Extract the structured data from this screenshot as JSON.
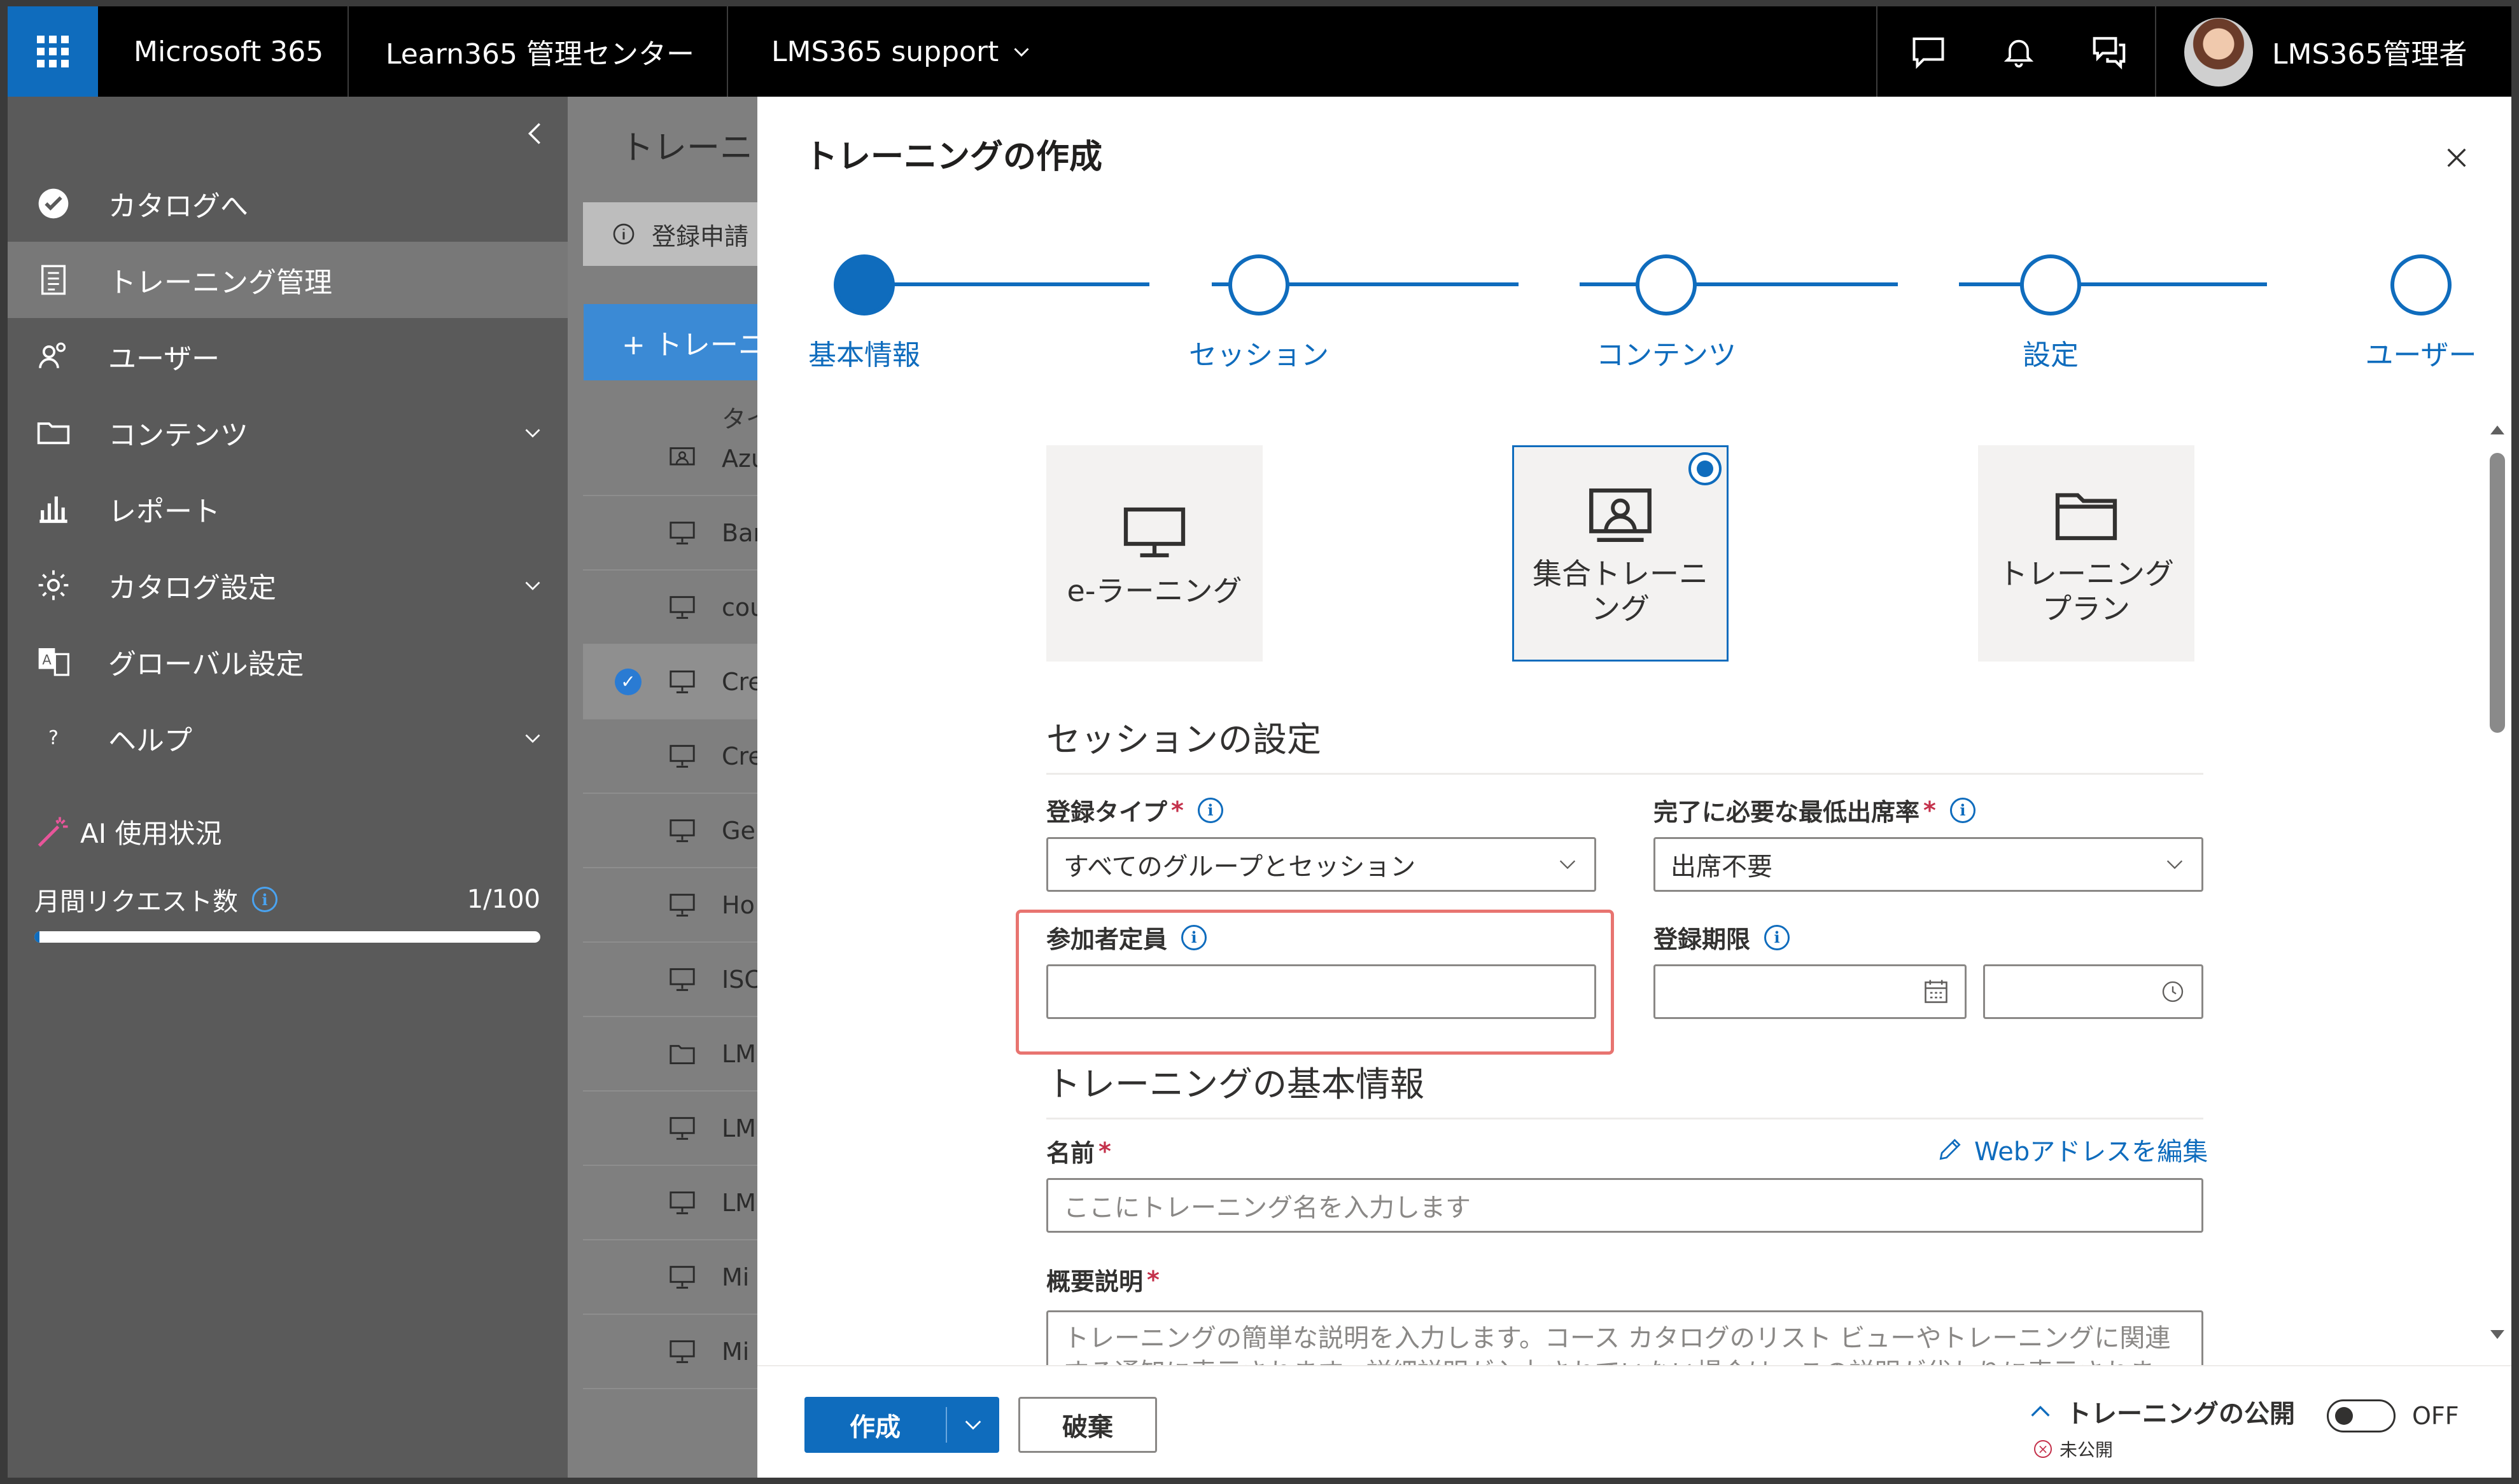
{
  "topbar": {
    "app_name": "Microsoft 365",
    "product_name": "Learn365 管理センター",
    "tenant_name": "LMS365 support",
    "user_name": "LMS365管理者"
  },
  "sidebar": {
    "items": [
      {
        "label": "カタログへ",
        "icon": "catalog-check-icon"
      },
      {
        "label": "トレーニング管理",
        "icon": "training-list-icon",
        "active": true
      },
      {
        "label": "ユーザー",
        "icon": "users-icon"
      },
      {
        "label": "コンテンツ",
        "icon": "folder-icon",
        "expandable": true
      },
      {
        "label": "レポート",
        "icon": "bar-chart-icon"
      },
      {
        "label": "カタログ設定",
        "icon": "gear-icon",
        "expandable": true
      },
      {
        "label": "グローバル設定",
        "icon": "translate-icon"
      },
      {
        "label": "ヘルプ",
        "icon": "question-icon",
        "expandable": true
      }
    ],
    "ai_usage": {
      "title": "AI 使用状況",
      "monthly_requests_label": "月間リクエスト数",
      "monthly_requests_value": "1/100",
      "monthly_requests_fraction": 0.01
    }
  },
  "background_page": {
    "title": "トレーニン",
    "notice": "登録申請",
    "new_button": "+ トレーニ",
    "column_header": "タイ",
    "rows": [
      {
        "text": "Azu",
        "icon": "classroom-icon"
      },
      {
        "text": "Bar",
        "icon": "monitor-icon"
      },
      {
        "text": "cou",
        "icon": "monitor-icon"
      },
      {
        "text": "Cre",
        "icon": "monitor-icon",
        "selected": true
      },
      {
        "text": "Cre",
        "icon": "monitor-icon"
      },
      {
        "text": "Ge",
        "icon": "monitor-icon"
      },
      {
        "text": "Ho",
        "icon": "monitor-icon"
      },
      {
        "text": "ISC",
        "icon": "monitor-icon"
      },
      {
        "text": "LM",
        "icon": "folder-icon"
      },
      {
        "text": "LM",
        "icon": "monitor-icon"
      },
      {
        "text": "LM",
        "icon": "monitor-icon"
      },
      {
        "text": "Mi",
        "icon": "monitor-icon"
      },
      {
        "text": "Mi",
        "icon": "monitor-icon"
      }
    ]
  },
  "dialog": {
    "title": "トレーニングの作成",
    "steps": [
      {
        "label": "基本情報",
        "done": true
      },
      {
        "label": "セッション",
        "done": false
      },
      {
        "label": "コンテンツ",
        "done": false
      },
      {
        "label": "設定",
        "done": false
      },
      {
        "label": "ユーザー",
        "done": false
      }
    ],
    "training_types": [
      {
        "label": "e-ラーニング",
        "icon": "monitor-icon",
        "selected": false
      },
      {
        "label": "集合トレーニング",
        "icon": "classroom-icon",
        "selected": true
      },
      {
        "label": "トレーニングプラン",
        "icon": "folder-icon",
        "selected": false
      }
    ],
    "session_settings": {
      "heading": "セッションの設定",
      "registration_type_label": "登録タイプ",
      "registration_type_value": "すべてのグループとセッション",
      "min_attendance_label": "完了に必要な最低出席率",
      "min_attendance_value": "出席不要",
      "capacity_label": "参加者定員",
      "capacity_value": "",
      "registration_deadline_label": "登録期限",
      "deadline_date_value": "",
      "deadline_time_value": ""
    },
    "basic_info": {
      "heading": "トレーニングの基本情報",
      "name_label": "名前",
      "edit_web_address": "Webアドレスを編集",
      "name_placeholder": "ここにトレーニング名を入力します",
      "summary_label": "概要説明",
      "summary_placeholder": "トレーニングの簡単な説明を入力します。コース カタログのリスト ビューやトレーニングに関連する通知に表示されます。詳細説明が入力されていない場合は、この説明が代わりに表示されます。"
    },
    "footer": {
      "create_label": "作成",
      "discard_label": "破棄",
      "publish_label": "トレーニングの公開",
      "publish_status": "未公開",
      "toggle_state": "OFF"
    }
  },
  "colors": {
    "accent": "#0f6cbd",
    "topbar": "#000000",
    "waffle": "#0f6cbd",
    "sidebar": "#5a5a5a",
    "highlight": "#e87470"
  }
}
